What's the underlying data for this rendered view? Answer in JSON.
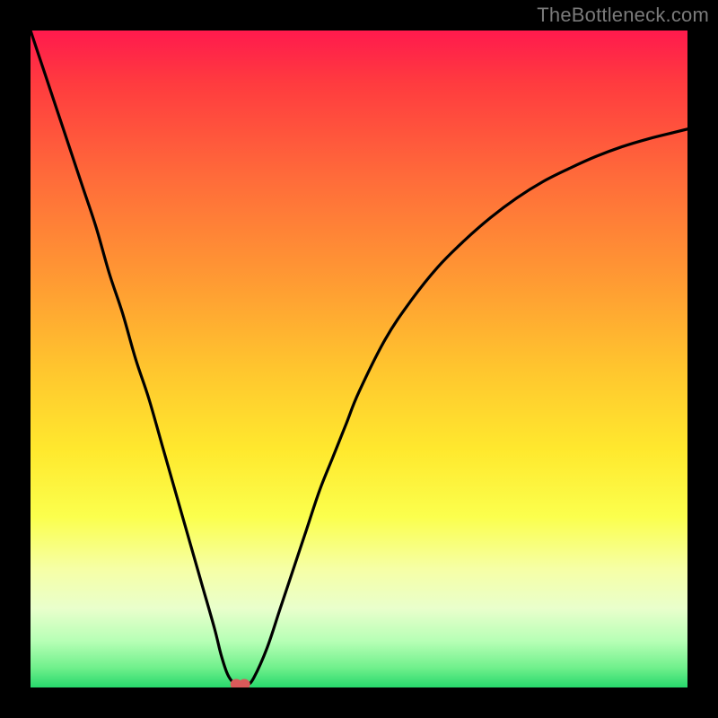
{
  "watermark": "TheBottleneck.com",
  "colors": {
    "gradient_top": "#ff1a4d",
    "gradient_mid_orange": "#ff9a33",
    "gradient_mid_yellow": "#ffe92e",
    "gradient_bottom": "#27d86c",
    "curve": "#000000",
    "marker": "#d85a5a",
    "frame": "#000000"
  },
  "chart_data": {
    "type": "line",
    "title": "",
    "xlabel": "",
    "ylabel": "",
    "xlim": [
      0,
      100
    ],
    "ylim": [
      0,
      100
    ],
    "x": [
      0,
      2,
      4,
      6,
      8,
      10,
      12,
      14,
      16,
      18,
      20,
      22,
      24,
      26,
      28,
      29,
      30,
      31,
      32,
      33,
      34,
      36,
      38,
      40,
      42,
      44,
      46,
      48,
      50,
      54,
      58,
      62,
      66,
      70,
      74,
      78,
      82,
      86,
      90,
      94,
      98,
      100
    ],
    "values": [
      100,
      94,
      88,
      82,
      76,
      70,
      63,
      57,
      50,
      44,
      37,
      30,
      23,
      16,
      9,
      5,
      2,
      0.6,
      0.2,
      0.4,
      1.5,
      6,
      12,
      18,
      24,
      30,
      35,
      40,
      45,
      53,
      59,
      64,
      68,
      71.5,
      74.5,
      77,
      79,
      80.8,
      82.3,
      83.5,
      84.5,
      85
    ],
    "marker": {
      "x": 32,
      "y": 0.2
    },
    "notes": "Values are percent of full scale read off a watermark-only chart with no axes. Curve is a V shape bottoming near x≈32 with the left limb steeper than the right."
  }
}
